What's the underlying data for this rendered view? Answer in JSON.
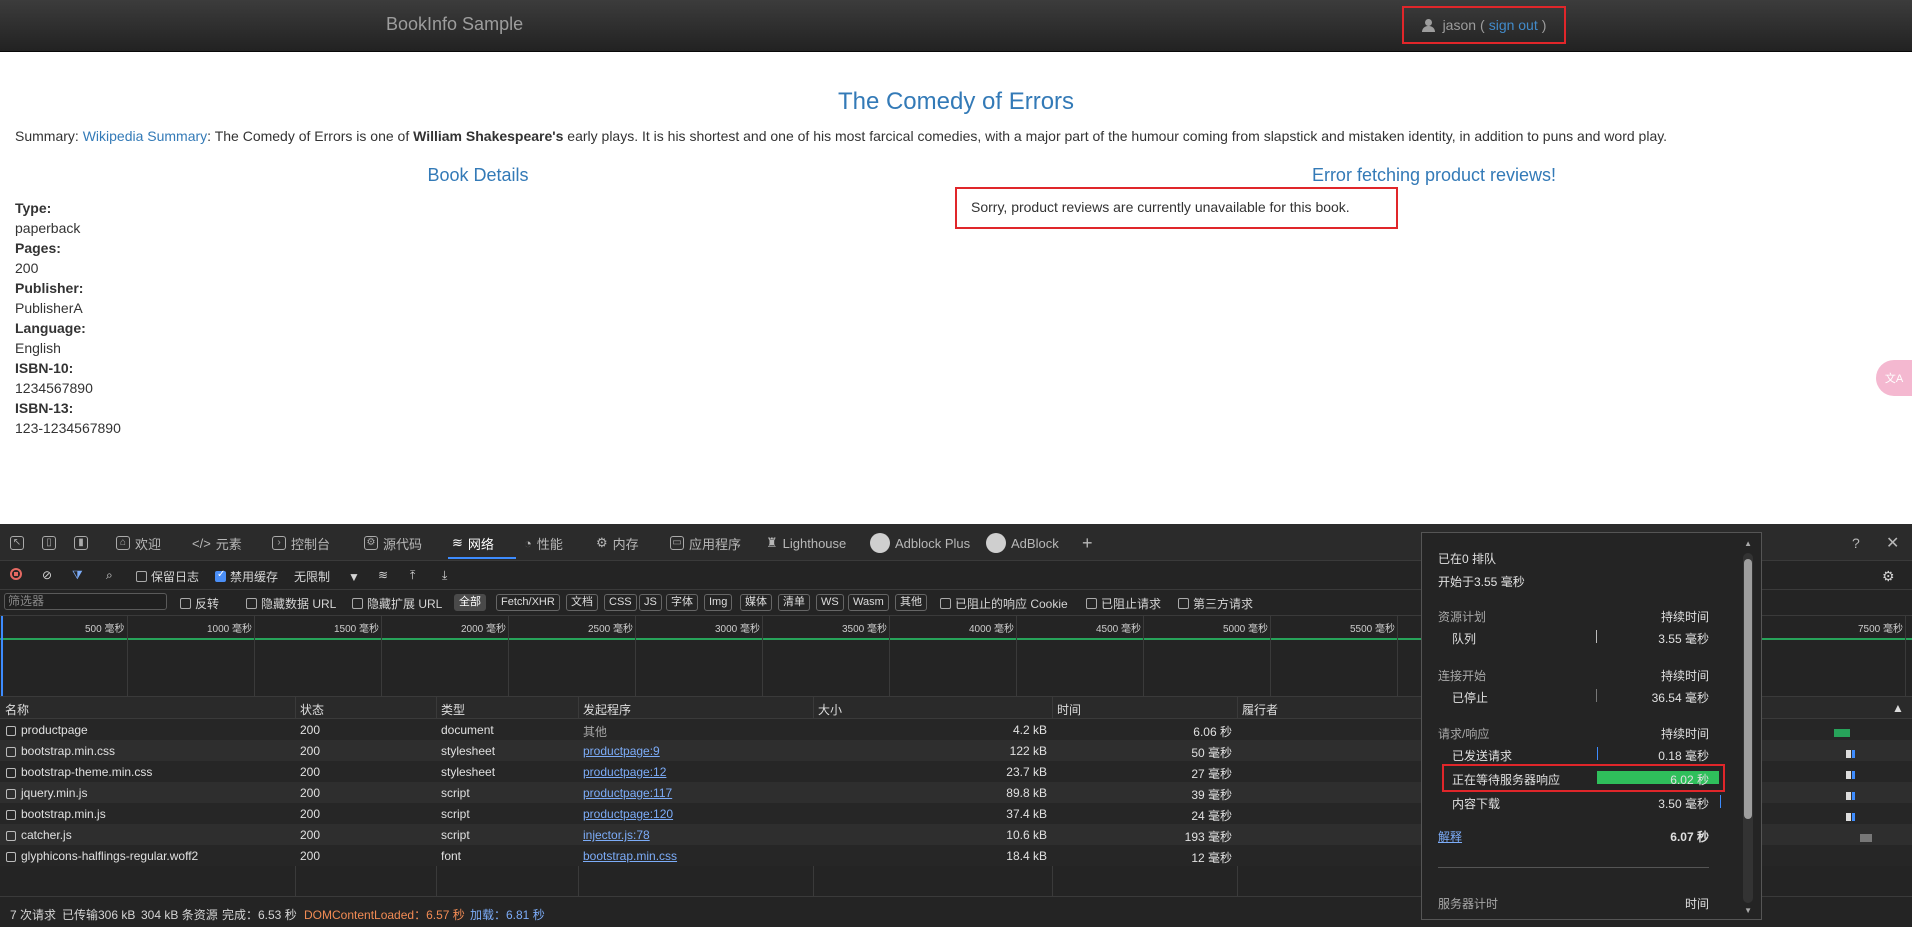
{
  "page": {
    "brand": "BookInfo Sample",
    "user": {
      "name": "jason",
      "open_paren": "(",
      "sign_out": "sign out",
      "close_paren": ")"
    },
    "title": "The Comedy of Errors",
    "summary": {
      "label": "Summary:",
      "link": "Wikipedia Summary",
      "text1": ": The Comedy of Errors is one of ",
      "bold": "William Shakespeare's",
      "text2": " early plays. It is his shortest and one of his most farcical comedies, with a major part of the humour coming from slapstick and mistaken identity, in addition to puns and word play."
    },
    "details_heading": "Book Details",
    "reviews_heading": "Error fetching product reviews!",
    "reviews_message": "Sorry, product reviews are currently unavailable for this book.",
    "details": [
      {
        "key": "Type:",
        "value": "paperback"
      },
      {
        "key": "Pages:",
        "value": "200"
      },
      {
        "key": "Publisher:",
        "value": "PublisherA"
      },
      {
        "key": "Language:",
        "value": "English"
      },
      {
        "key": "ISBN-10:",
        "value": "1234567890"
      },
      {
        "key": "ISBN-13:",
        "value": "123-1234567890"
      }
    ]
  },
  "devtools": {
    "tabs": [
      "欢迎",
      "元素",
      "控制台",
      "源代码",
      "网络",
      "性能",
      "内存",
      "应用程序",
      "Lighthouse",
      "Adblock Plus",
      "AdBlock"
    ],
    "active_tab": "网络",
    "toolbar": {
      "preserve_log": "保留日志",
      "disable_cache": "禁用缓存",
      "throttle": "无限制"
    },
    "filter": {
      "placeholder": "筛选器",
      "invert": "反转",
      "hide_data_url": "隐藏数据 URL",
      "hide_ext_url": "隐藏扩展 URL",
      "types": [
        "全部",
        "Fetch/XHR",
        "文档",
        "CSS",
        "JS",
        "字体",
        "Img",
        "媒体",
        "清单",
        "WS",
        "Wasm",
        "其他"
      ],
      "blocked_cookies": "已阻止的响应 Cookie",
      "blocked_requests": "已阻止请求",
      "third_party": "第三方请求"
    },
    "timeline_ticks": [
      "500 毫秒",
      "1000 毫秒",
      "1500 毫秒",
      "2000 毫秒",
      "2500 毫秒",
      "3000 毫秒",
      "3500 毫秒",
      "4000 毫秒",
      "4500 毫秒",
      "5000 毫秒",
      "5500 毫秒",
      "7500 毫秒"
    ],
    "columns": [
      "名称",
      "状态",
      "类型",
      "发起程序",
      "大小",
      "时间",
      "履行者"
    ],
    "rows": [
      {
        "name": "productpage",
        "status": "200",
        "type": "document",
        "initiator": "其他",
        "size": "4.2 kB",
        "time": "6.06 秒"
      },
      {
        "name": "bootstrap.min.css",
        "status": "200",
        "type": "stylesheet",
        "initiator": "productpage:9",
        "size": "122 kB",
        "time": "50  毫秒"
      },
      {
        "name": "bootstrap-theme.min.css",
        "status": "200",
        "type": "stylesheet",
        "initiator": "productpage:12",
        "size": "23.7 kB",
        "time": "27  毫秒"
      },
      {
        "name": "jquery.min.js",
        "status": "200",
        "type": "script",
        "initiator": "productpage:117",
        "size": "89.8 kB",
        "time": "39  毫秒"
      },
      {
        "name": "bootstrap.min.js",
        "status": "200",
        "type": "script",
        "initiator": "productpage:120",
        "size": "37.4 kB",
        "time": "24  毫秒"
      },
      {
        "name": "catcher.js",
        "status": "200",
        "type": "script",
        "initiator": "injector.js:78",
        "size": "10.6 kB",
        "time": "193  毫秒"
      },
      {
        "name": "glyphicons-halflings-regular.woff2",
        "status": "200",
        "type": "font",
        "initiator": "bootstrap.min.css",
        "size": "18.4 kB",
        "time": "12  毫秒"
      }
    ],
    "status": {
      "requests": "7 次请求",
      "transferred": "已传输306 kB",
      "resources": "304 kB 条资源",
      "finish": "完成：6.53 秒",
      "dcl": "DOMContentLoaded：6.57 秒",
      "load": "加载：6.81 秒"
    },
    "timing": {
      "queued_at": "已在0 排队",
      "started_at": "开始于3.55  毫秒",
      "sec_resource": "资源计划",
      "sec_connection": "连接开始",
      "sec_request": "请求/响应",
      "duration_label": "持续时间",
      "queue": "队列",
      "queue_value": "3.55  毫秒",
      "stalled": "已停止",
      "stalled_value": "36.54  毫秒",
      "sent": "已发送请求",
      "sent_value": "0.18  毫秒",
      "waiting": "正在等待服务器响应",
      "waiting_value": "6.02 秒",
      "download": "内容下载",
      "download_value": "3.50  毫秒",
      "explain": "解释",
      "total": "6.07 秒",
      "server_timing": "服务器计时",
      "time_label": "时间"
    }
  },
  "colors": {
    "accent": "#337ab7",
    "highlight": "#e0262a",
    "waiting_bar": "#2fbf5b",
    "devtools_bg": "#242424"
  }
}
